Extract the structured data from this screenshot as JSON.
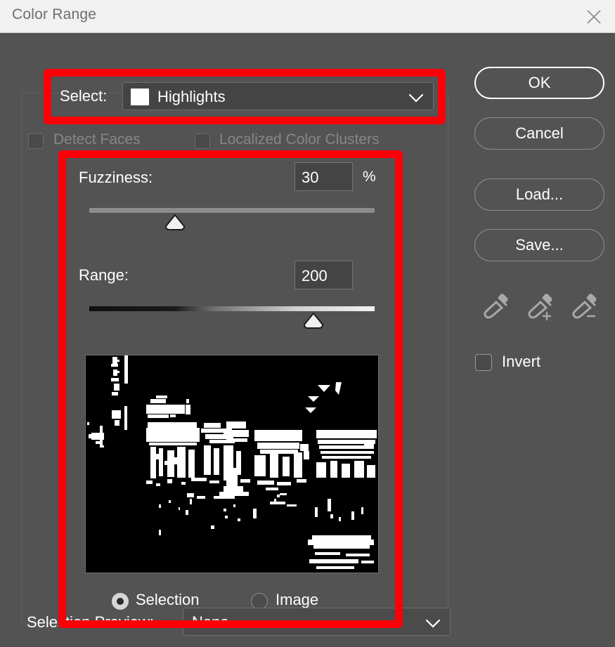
{
  "window": {
    "title": "Color Range",
    "close_icon": "close-icon"
  },
  "select_row": {
    "label": "Select:",
    "value": "Highlights",
    "swatch_color": "#ffffff",
    "chevron_icon": "chevron-down-icon",
    "options": [
      "Highlights"
    ]
  },
  "checkboxes": {
    "detect_faces": {
      "label": "Detect Faces",
      "checked": false,
      "disabled": true
    },
    "localized_color_clusters": {
      "label": "Localized Color Clusters",
      "checked": false,
      "disabled": true
    }
  },
  "fuzziness": {
    "label": "Fuzziness:",
    "value": "30",
    "unit": "%",
    "slider_percent": 28
  },
  "range": {
    "label": "Range:",
    "value": "200",
    "slider_percent": 77
  },
  "preview": {
    "name": "selection-mask-preview",
    "description": "Black and white selection mask of a night street scene with illuminated signs"
  },
  "preview_mode": {
    "selection": {
      "label": "Selection",
      "selected": true
    },
    "image": {
      "label": "Image",
      "selected": false
    }
  },
  "selection_preview": {
    "label": "Selection Preview:",
    "value": "None",
    "chevron_icon": "chevron-down-icon",
    "options": [
      "None"
    ]
  },
  "buttons": {
    "ok": "OK",
    "cancel": "Cancel",
    "load": "Load...",
    "save": "Save..."
  },
  "eyedroppers": [
    {
      "name": "eyedropper-icon",
      "modifier": ""
    },
    {
      "name": "eyedropper-add-icon",
      "modifier": "+"
    },
    {
      "name": "eyedropper-subtract-icon",
      "modifier": "−"
    }
  ],
  "invert": {
    "label": "Invert",
    "checked": false
  },
  "annotations": {
    "highlight_color": "#fb0007",
    "boxes": [
      {
        "name": "select-row-highlight"
      },
      {
        "name": "controls-group-highlight"
      }
    ]
  },
  "colors": {
    "dialog_bg": "#535353",
    "titlebar_bg": "#f1f1f1",
    "field_bg": "#444444",
    "text": "#ffffff",
    "text_disabled": "#878787"
  }
}
